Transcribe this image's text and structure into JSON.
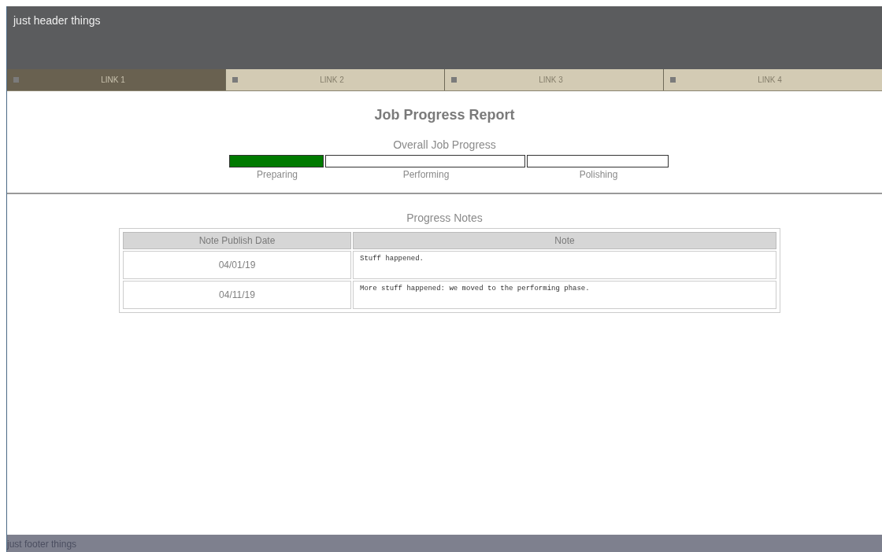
{
  "header": {
    "title": "just header things"
  },
  "nav": [
    {
      "label": "LINK 1",
      "selected": true
    },
    {
      "label": "LINK 2",
      "selected": false
    },
    {
      "label": "LINK 3",
      "selected": false
    },
    {
      "label": "LINK 4",
      "selected": false
    }
  ],
  "report": {
    "title": "Job Progress Report",
    "progress_title": "Overall Job Progress",
    "stages": [
      {
        "label": "Preparing",
        "complete": true
      },
      {
        "label": "Performing",
        "complete": false
      },
      {
        "label": "Polishing",
        "complete": false
      }
    ]
  },
  "notes": {
    "title": "Progress Notes",
    "columns": [
      "Note Publish Date",
      "Note"
    ],
    "rows": [
      {
        "date": "04/01/19",
        "note": "Stuff happened."
      },
      {
        "date": "04/11/19",
        "note": "More stuff happened: we moved to the performing phase."
      }
    ]
  },
  "footer": {
    "text": "just footer things"
  }
}
